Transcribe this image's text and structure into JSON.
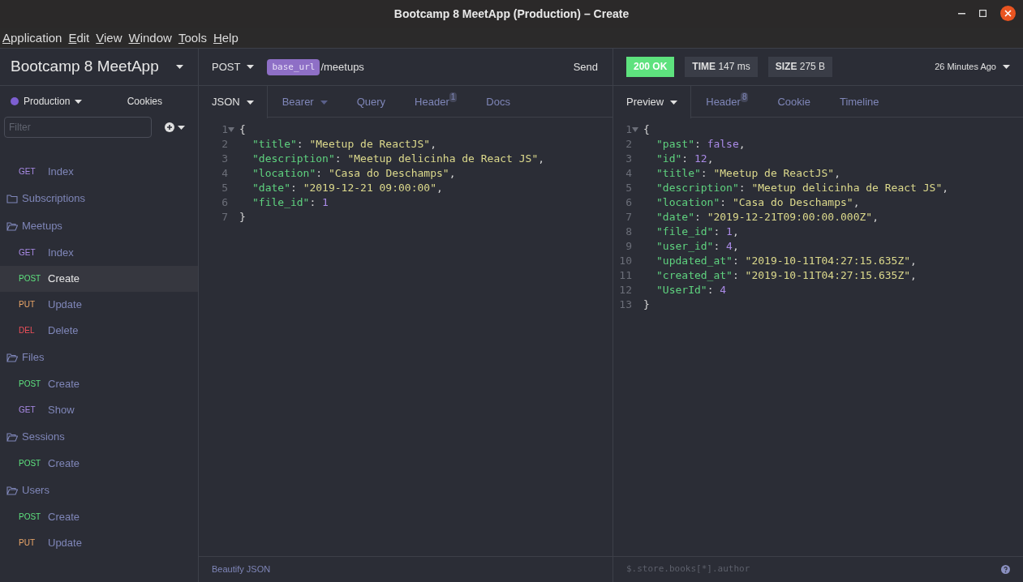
{
  "window": {
    "title": "Bootcamp 8 MeetApp (Production) – Create"
  },
  "menu": [
    {
      "label": "Application"
    },
    {
      "label": "Edit"
    },
    {
      "label": "View"
    },
    {
      "label": "Window"
    },
    {
      "label": "Tools"
    },
    {
      "label": "Help"
    }
  ],
  "sidebar": {
    "workspace": "Bootcamp 8 MeetApp",
    "environment": {
      "label": "Production",
      "color": "#7d5fd1"
    },
    "cookies": "Cookies",
    "filter": {
      "placeholder": "Filter"
    },
    "items": [
      {
        "kind": "request",
        "method": "GET",
        "color": "#a98ae6",
        "name": "Index",
        "selected": false
      },
      {
        "kind": "folder",
        "name": "Subscriptions",
        "expanded": false
      },
      {
        "kind": "folder",
        "name": "Meetups",
        "expanded": true
      },
      {
        "kind": "request",
        "method": "GET",
        "color": "#a98ae6",
        "name": "Index",
        "selected": false
      },
      {
        "kind": "request",
        "method": "POST",
        "color": "#5ee27e",
        "name": "Create",
        "selected": true
      },
      {
        "kind": "request",
        "method": "PUT",
        "color": "#eea869",
        "name": "Update",
        "selected": false
      },
      {
        "kind": "request",
        "method": "DEL",
        "color": "#f0505a",
        "name": "Delete",
        "selected": false
      },
      {
        "kind": "folder",
        "name": "Files",
        "expanded": true
      },
      {
        "kind": "request",
        "method": "POST",
        "color": "#5ee27e",
        "name": "Create",
        "selected": false
      },
      {
        "kind": "request",
        "method": "GET",
        "color": "#a98ae6",
        "name": "Show",
        "selected": false
      },
      {
        "kind": "folder",
        "name": "Sessions",
        "expanded": true
      },
      {
        "kind": "request",
        "method": "POST",
        "color": "#5ee27e",
        "name": "Create",
        "selected": false
      },
      {
        "kind": "folder",
        "name": "Users",
        "expanded": true
      },
      {
        "kind": "request",
        "method": "POST",
        "color": "#5ee27e",
        "name": "Create",
        "selected": false
      },
      {
        "kind": "request",
        "method": "PUT",
        "color": "#eea869",
        "name": "Update",
        "selected": false
      }
    ]
  },
  "request": {
    "method": "POST",
    "variable": "base_url",
    "path": "/meetups",
    "send": "Send",
    "tabs": [
      {
        "label": "JSON",
        "dropdown": true,
        "selected": true
      },
      {
        "label": "Bearer",
        "dropdown": true,
        "selected": false
      },
      {
        "label": "Query",
        "selected": false
      },
      {
        "label": "Header",
        "badge": "1",
        "selected": false
      },
      {
        "label": "Docs",
        "selected": false
      }
    ],
    "lines": [
      {
        "number": "1",
        "fold": true,
        "tokens": [
          {
            "kind": "punct",
            "text": "{"
          }
        ]
      },
      {
        "number": "2",
        "indented": true,
        "tokens": [
          {
            "kind": "key",
            "text": "\"title\""
          },
          {
            "kind": "punct",
            "text": ": "
          },
          {
            "kind": "string",
            "text": "\"Meetup de ReactJS\""
          },
          {
            "kind": "punct",
            "text": ","
          }
        ]
      },
      {
        "number": "3",
        "indented": true,
        "tokens": [
          {
            "kind": "key",
            "text": "\"description\""
          },
          {
            "kind": "punct",
            "text": ": "
          },
          {
            "kind": "string",
            "text": "\"Meetup delicinha de React JS\""
          },
          {
            "kind": "punct",
            "text": ","
          }
        ]
      },
      {
        "number": "4",
        "indented": true,
        "tokens": [
          {
            "kind": "key",
            "text": "\"location\""
          },
          {
            "kind": "punct",
            "text": ": "
          },
          {
            "kind": "string",
            "text": "\"Casa do Deschamps\""
          },
          {
            "kind": "punct",
            "text": ","
          }
        ]
      },
      {
        "number": "5",
        "indented": true,
        "tokens": [
          {
            "kind": "key",
            "text": "\"date\""
          },
          {
            "kind": "punct",
            "text": ": "
          },
          {
            "kind": "string",
            "text": "\"2019-12-21 09:00:00\""
          },
          {
            "kind": "punct",
            "text": ","
          }
        ]
      },
      {
        "number": "6",
        "indented": true,
        "tokens": [
          {
            "kind": "key",
            "text": "\"file_id\""
          },
          {
            "kind": "punct",
            "text": ": "
          },
          {
            "kind": "number",
            "text": "1"
          }
        ]
      },
      {
        "number": "7",
        "tokens": [
          {
            "kind": "punct",
            "text": "}"
          }
        ]
      }
    ],
    "footer": "Beautify JSON"
  },
  "response": {
    "status": "200 OK",
    "time": {
      "label": "TIME",
      "value": "147 ms"
    },
    "size": {
      "label": "SIZE",
      "value": "275 B"
    },
    "history": "26 Minutes Ago",
    "tabs": [
      {
        "label": "Preview",
        "dropdown": true,
        "selected": true
      },
      {
        "label": "Header",
        "badge": "8",
        "selected": false
      },
      {
        "label": "Cookie",
        "selected": false
      },
      {
        "label": "Timeline",
        "selected": false
      }
    ],
    "lines": [
      {
        "number": "1",
        "fold": true,
        "tokens": [
          {
            "kind": "punct",
            "text": "{"
          }
        ]
      },
      {
        "number": "2",
        "indented": true,
        "tokens": [
          {
            "kind": "key",
            "text": "\"past\""
          },
          {
            "kind": "punct",
            "text": ": "
          },
          {
            "kind": "number",
            "text": "false"
          },
          {
            "kind": "punct",
            "text": ","
          }
        ]
      },
      {
        "number": "3",
        "indented": true,
        "tokens": [
          {
            "kind": "key",
            "text": "\"id\""
          },
          {
            "kind": "punct",
            "text": ": "
          },
          {
            "kind": "number",
            "text": "12"
          },
          {
            "kind": "punct",
            "text": ","
          }
        ]
      },
      {
        "number": "4",
        "indented": true,
        "tokens": [
          {
            "kind": "key",
            "text": "\"title\""
          },
          {
            "kind": "punct",
            "text": ": "
          },
          {
            "kind": "string",
            "text": "\"Meetup de ReactJS\""
          },
          {
            "kind": "punct",
            "text": ","
          }
        ]
      },
      {
        "number": "5",
        "indented": true,
        "tokens": [
          {
            "kind": "key",
            "text": "\"description\""
          },
          {
            "kind": "punct",
            "text": ": "
          },
          {
            "kind": "string",
            "text": "\"Meetup delicinha de React JS\""
          },
          {
            "kind": "punct",
            "text": ","
          }
        ]
      },
      {
        "number": "6",
        "indented": true,
        "tokens": [
          {
            "kind": "key",
            "text": "\"location\""
          },
          {
            "kind": "punct",
            "text": ": "
          },
          {
            "kind": "string",
            "text": "\"Casa do Deschamps\""
          },
          {
            "kind": "punct",
            "text": ","
          }
        ]
      },
      {
        "number": "7",
        "indented": true,
        "tokens": [
          {
            "kind": "key",
            "text": "\"date\""
          },
          {
            "kind": "punct",
            "text": ": "
          },
          {
            "kind": "string",
            "text": "\"2019-12-21T09:00:00.000Z\""
          },
          {
            "kind": "punct",
            "text": ","
          }
        ]
      },
      {
        "number": "8",
        "indented": true,
        "tokens": [
          {
            "kind": "key",
            "text": "\"file_id\""
          },
          {
            "kind": "punct",
            "text": ": "
          },
          {
            "kind": "number",
            "text": "1"
          },
          {
            "kind": "punct",
            "text": ","
          }
        ]
      },
      {
        "number": "9",
        "indented": true,
        "tokens": [
          {
            "kind": "key",
            "text": "\"user_id\""
          },
          {
            "kind": "punct",
            "text": ": "
          },
          {
            "kind": "number",
            "text": "4"
          },
          {
            "kind": "punct",
            "text": ","
          }
        ]
      },
      {
        "number": "10",
        "indented": true,
        "tokens": [
          {
            "kind": "key",
            "text": "\"updated_at\""
          },
          {
            "kind": "punct",
            "text": ": "
          },
          {
            "kind": "string",
            "text": "\"2019-10-11T04:27:15.635Z\""
          },
          {
            "kind": "punct",
            "text": ","
          }
        ]
      },
      {
        "number": "11",
        "indented": true,
        "tokens": [
          {
            "kind": "key",
            "text": "\"created_at\""
          },
          {
            "kind": "punct",
            "text": ": "
          },
          {
            "kind": "string",
            "text": "\"2019-10-11T04:27:15.635Z\""
          },
          {
            "kind": "punct",
            "text": ","
          }
        ]
      },
      {
        "number": "12",
        "indented": true,
        "tokens": [
          {
            "kind": "key",
            "text": "\"UserId\""
          },
          {
            "kind": "punct",
            "text": ": "
          },
          {
            "kind": "number",
            "text": "4"
          }
        ]
      },
      {
        "number": "13",
        "tokens": [
          {
            "kind": "punct",
            "text": "}"
          }
        ]
      }
    ],
    "filter": {
      "placeholder": "$.store.books[*].author"
    }
  }
}
